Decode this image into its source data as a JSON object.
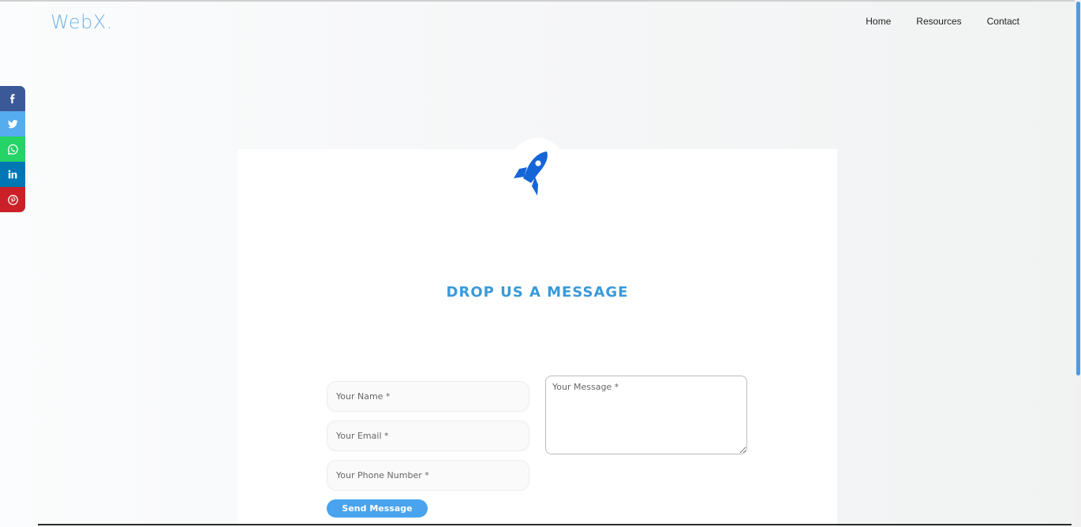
{
  "brand": {
    "logo": "WebX."
  },
  "nav": {
    "items": [
      "Home",
      "Resources",
      "Contact"
    ]
  },
  "social": [
    {
      "icon": "facebook-icon",
      "glyph": "f",
      "color": "#3b5998"
    },
    {
      "icon": "twitter-icon",
      "glyph": "t",
      "color": "#55acee"
    },
    {
      "icon": "whatsapp-icon",
      "glyph": "w",
      "color": "#25d366"
    },
    {
      "icon": "linkedin-icon",
      "glyph": "in",
      "color": "#0077b5"
    },
    {
      "icon": "pinterest-icon",
      "glyph": "p",
      "color": "#cb2027"
    }
  ],
  "contact": {
    "heading": "DROP US A MESSAGE",
    "name_placeholder": "Your Name *",
    "email_placeholder": "Your Email *",
    "phone_placeholder": "Your Phone Number *",
    "message_placeholder": "Your Message *",
    "submit_label": "Send Message"
  },
  "colors": {
    "accent": "#3a9ad9",
    "button": "#4aa3ee",
    "rocket": "#1565d8"
  }
}
